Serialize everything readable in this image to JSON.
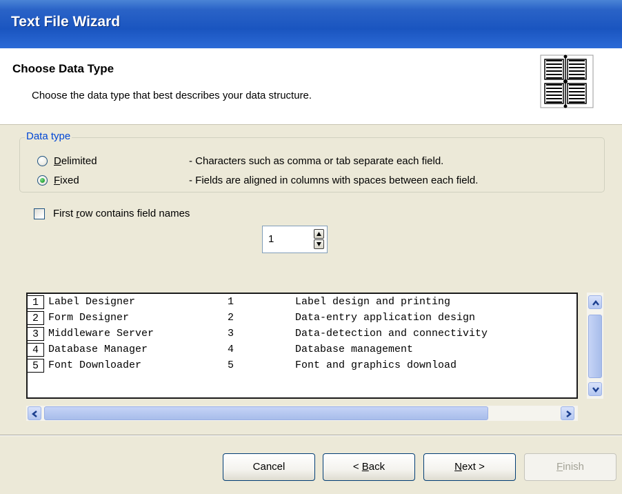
{
  "window": {
    "title": "Text File Wizard"
  },
  "header": {
    "title": "Choose Data Type",
    "description": "Choose the data type that best describes your data structure.",
    "icon": "columns-layout-icon"
  },
  "data_type": {
    "legend": "Data type",
    "options": [
      {
        "label_accel": "D",
        "label_rest": "elimited",
        "description": "- Characters such as comma or tab separate each field.",
        "selected": false
      },
      {
        "label_accel": "F",
        "label_rest": "ixed",
        "description": "- Fields are aligned in columns with spaces between each field.",
        "selected": true
      }
    ]
  },
  "first_row": {
    "label_pre": "First ",
    "label_accel": "r",
    "label_post": "ow contains field names",
    "checked": false
  },
  "start_row": {
    "value": "1"
  },
  "preview": {
    "rows": [
      {
        "num": "1",
        "name": "Label Designer",
        "id": "1",
        "desc": "Label design and printing"
      },
      {
        "num": "2",
        "name": "Form Designer",
        "id": "2",
        "desc": "Data-entry application design"
      },
      {
        "num": "3",
        "name": "Middleware Server",
        "id": "3",
        "desc": "Data-detection and connectivity"
      },
      {
        "num": "4",
        "name": "Database Manager",
        "id": "4",
        "desc": "Database management"
      },
      {
        "num": "5",
        "name": "Font Downloader",
        "id": "5",
        "desc": "Font and graphics download"
      }
    ]
  },
  "buttons": {
    "cancel": "Cancel",
    "back_pre": "< ",
    "back_accel": "B",
    "back_post": "ack",
    "next_accel": "N",
    "next_post": "ext >",
    "finish_accel": "F",
    "finish_post": "inish"
  },
  "colors": {
    "title_bar": "#1a55c0",
    "dialog_bg": "#ece9d8",
    "group_legend": "#0046d5",
    "radio_selected": "#2fa83f"
  }
}
